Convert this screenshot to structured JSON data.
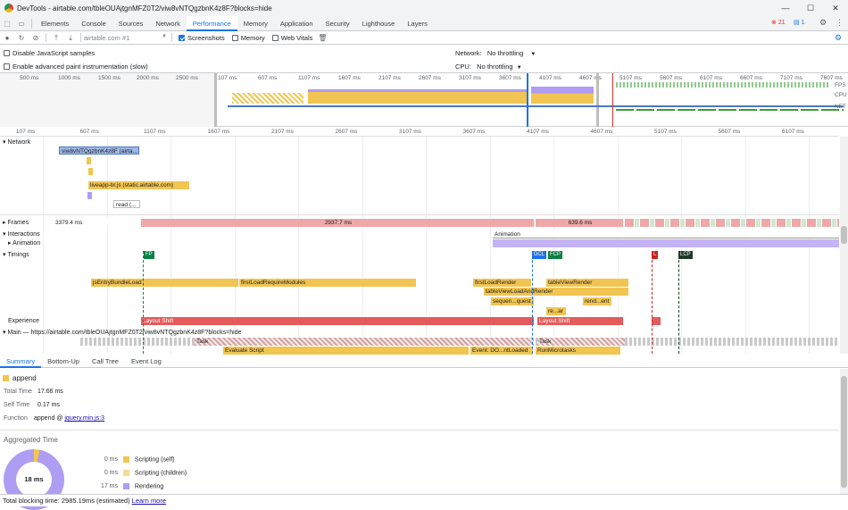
{
  "window": {
    "title": "DevTools - airtable.com/tbleOUAjtgnMFZ0T2/viw8vNTQgzbnK4z8F?blocks=hide",
    "controls": [
      "—",
      "☐",
      "✕"
    ]
  },
  "tabs": {
    "items": [
      "Elements",
      "Console",
      "Sources",
      "Network",
      "Performance",
      "Memory",
      "Application",
      "Security",
      "Lighthouse",
      "Layers"
    ],
    "active": "Performance",
    "error_badge": "21",
    "message_badge": "1"
  },
  "toolbar": {
    "profile_select": "airtable.com #1",
    "screenshots_label": "Screenshots",
    "memory_label": "Memory",
    "webvitals_label": "Web Vitals"
  },
  "settings": {
    "disable_js_label": "Disable JavaScript samples",
    "adv_paint_label": "Enable advanced paint instrumentation (slow)",
    "network_label": "Network:",
    "network_value": "No throttling",
    "cpu_label": "CPU:",
    "cpu_value": "No throttling"
  },
  "overview": {
    "ticks_left": [
      "500 ms",
      "1000 ms",
      "1500 ms",
      "2000 ms",
      "2500 ms"
    ],
    "ticks_right": [
      "107 ms",
      "607 ms",
      "1107 ms",
      "1607 ms",
      "2107 ms",
      "2607 ms",
      "3107 ms",
      "3607 ms",
      "4107 ms",
      "4607 ms",
      "5107 ms",
      "5607 ms",
      "6107 ms",
      "6607 ms",
      "7107 ms",
      "7607 ms"
    ],
    "labels": {
      "fps": "FPS",
      "cpu": "CPU",
      "net": "NET"
    }
  },
  "ruler": {
    "ticks": [
      "107 ms",
      "607 ms",
      "1107 ms",
      "1607 ms",
      "2107 ms",
      "2607 ms",
      "3107 ms",
      "3607 ms",
      "4107 ms",
      "4607 ms",
      "5107 ms",
      "5607 ms",
      "6107 ms"
    ]
  },
  "tracks": {
    "network": "Network",
    "net_bars": [
      "viw8vNTQgzbnK4z8F (airta...",
      "liveapp-br.js (static.airtable.com)",
      "read (..."
    ],
    "frames": "Frames",
    "frames_values": [
      "3379.4 ms",
      "2937.7 ms",
      "639.6 ms"
    ],
    "interactions": "Interactions",
    "animation": "Animation",
    "animation_bar": "Animation",
    "timings": "Timings",
    "markers": [
      "FP",
      "DCL",
      "FCP",
      "L",
      "LCP"
    ],
    "timing_bars": [
      "jsEntryBundleLoad",
      "firstLoadRequireModules",
      "firstLoadRender",
      "tableViewRender",
      "tableViewLoadAndRender",
      "sequen...quest",
      "rend...ent",
      "re...ar"
    ],
    "experience": "Experience",
    "layout_shift_1": "Layout Shift",
    "layout_shift_2": "Layout Shift",
    "main": "Main — https://airtable.com/tbleOUAjtgnMFZ0T2/viw8vNTQgzbnK4z8F?blocks=hide",
    "main_bars": [
      "Task",
      "Task",
      "Evaluate Script",
      "Event: DO...ntLoaded",
      "RunMicrotasks"
    ]
  },
  "bottom_tabs": {
    "items": [
      "Summary",
      "Bottom-Up",
      "Call Tree",
      "Event Log"
    ],
    "active": "Summary"
  },
  "summary": {
    "event_name": "append",
    "total_time_label": "Total Time",
    "total_time": "17.66 ms",
    "self_time_label": "Self Time",
    "self_time": "0.17 ms",
    "function_label": "Function",
    "function_name": "append @",
    "function_link": "jquery.min.js:3",
    "aggregated_title": "Aggregated Time",
    "donut_center": "18 ms",
    "rows": [
      {
        "value": "0 ms",
        "label": "Scripting (self)",
        "color": "#f2c552"
      },
      {
        "value": "0 ms",
        "label": "Scripting (children)",
        "color": "#f2c552"
      },
      {
        "value": "17 ms",
        "label": "Rendering",
        "color": "#af9cf3"
      }
    ]
  },
  "footer": {
    "text": "Total blocking time: 2985.19ms (estimated)",
    "link": "Learn more"
  },
  "colors": {
    "scripting": "#f2c552",
    "rendering": "#af9cf3",
    "frame_red": "#f19b9b",
    "accent": "#1a73e8"
  }
}
